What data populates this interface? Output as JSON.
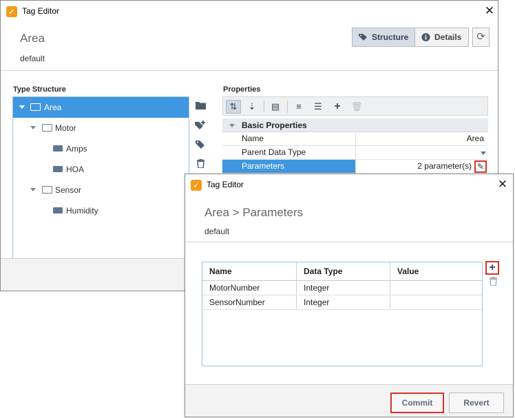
{
  "main_window": {
    "title": "Tag Editor",
    "header_title": "Area",
    "header_subtitle": "default",
    "view_toggle": {
      "structure_label": "Structure",
      "details_label": "Details"
    },
    "type_structure": {
      "label": "Type Structure",
      "tree": [
        {
          "label": "Area",
          "level": 0,
          "icon": "udt-definition-icon",
          "selected": true,
          "expanded": true
        },
        {
          "label": "Motor",
          "level": 1,
          "icon": "udt-definition-icon",
          "expanded": true
        },
        {
          "label": "Amps",
          "level": 2,
          "icon": "udt-instance-icon"
        },
        {
          "label": "HOA",
          "level": 2,
          "icon": "udt-instance-icon"
        },
        {
          "label": "Sensor",
          "level": 1,
          "icon": "udt-definition-icon",
          "expanded": true
        },
        {
          "label": "Humidity",
          "level": 2,
          "icon": "udt-instance-icon"
        }
      ]
    },
    "properties": {
      "label": "Properties",
      "category": "Basic Properties",
      "rows": [
        {
          "name": "Name",
          "value": "Area"
        },
        {
          "name": "Parent Data Type",
          "value": ""
        },
        {
          "name": "Parameters",
          "value": "2 parameter(s)"
        }
      ]
    }
  },
  "param_dialog": {
    "title": "Tag Editor",
    "header_title": "Area > Parameters",
    "header_subtitle": "default",
    "columns": [
      "Name",
      "Data Type",
      "Value"
    ],
    "rows": [
      {
        "name": "MotorNumber",
        "data_type": "Integer",
        "value": ""
      },
      {
        "name": "SensorNumber",
        "data_type": "Integer",
        "value": ""
      }
    ],
    "commit_label": "Commit",
    "revert_label": "Revert"
  },
  "colors": {
    "selection_blue": "#3e97e0",
    "highlight_red": "#d9312b",
    "app_icon_orange": "#f39a1b"
  }
}
